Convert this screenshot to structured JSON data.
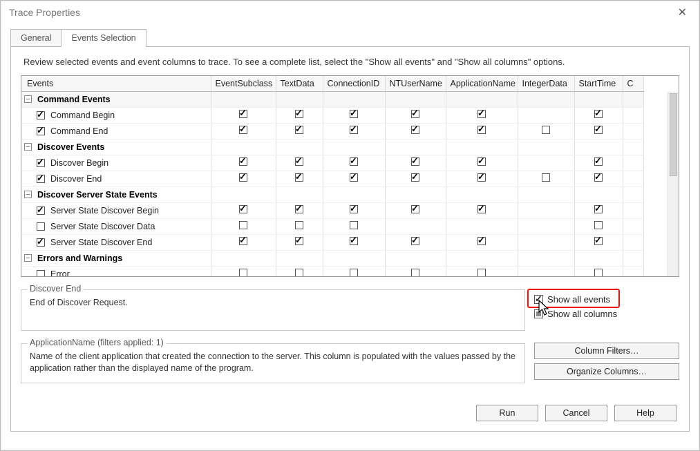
{
  "window": {
    "title": "Trace Properties"
  },
  "tabs": {
    "general": "General",
    "events": "Events Selection",
    "active": "events"
  },
  "hint": "Review selected events and event columns to trace. To see a complete list, select the \"Show all events\" and \"Show all columns\" options.",
  "columns": {
    "events": "Events",
    "c1": "EventSubclass",
    "c2": "TextData",
    "c3": "ConnectionID",
    "c4": "NTUserName",
    "c5": "ApplicationName",
    "c6": "IntegerData",
    "c7": "StartTime",
    "c8": "C"
  },
  "groups": [
    {
      "name": "Command Events",
      "expanded": true,
      "rows": [
        {
          "label": "Command Begin",
          "sel": true,
          "cells": [
            true,
            true,
            true,
            true,
            true,
            null,
            true
          ]
        },
        {
          "label": "Command End",
          "sel": true,
          "cells": [
            true,
            true,
            true,
            true,
            true,
            false,
            true
          ]
        }
      ]
    },
    {
      "name": "Discover Events",
      "expanded": true,
      "rows": [
        {
          "label": "Discover Begin",
          "sel": true,
          "cells": [
            true,
            true,
            true,
            true,
            true,
            null,
            true
          ]
        },
        {
          "label": "Discover End",
          "sel": true,
          "cells": [
            true,
            true,
            true,
            true,
            true,
            false,
            true
          ]
        }
      ]
    },
    {
      "name": "Discover Server State Events",
      "expanded": true,
      "rows": [
        {
          "label": "Server State Discover Begin",
          "sel": true,
          "cells": [
            true,
            true,
            true,
            true,
            true,
            null,
            true
          ]
        },
        {
          "label": "Server State Discover Data",
          "sel": false,
          "cells": [
            false,
            false,
            false,
            null,
            null,
            null,
            false
          ]
        },
        {
          "label": "Server State Discover End",
          "sel": true,
          "cells": [
            true,
            true,
            true,
            true,
            true,
            null,
            true
          ]
        }
      ]
    },
    {
      "name": "Errors and Warnings",
      "expanded": true,
      "rows": [
        {
          "label": "Error",
          "sel": false,
          "cells": [
            false,
            false,
            false,
            false,
            false,
            null,
            false
          ]
        }
      ]
    }
  ],
  "detail": {
    "legend": "Discover End",
    "text": "End of Discover Request."
  },
  "show_all": {
    "events": {
      "label": "Show all events",
      "checked": true
    },
    "columns": {
      "label": "Show all columns",
      "checked": "partial"
    }
  },
  "filterbox": {
    "legend": "ApplicationName (filters applied: 1)",
    "text": "Name of the client application that created the connection to the server. This column is populated with the values passed by the application rather than the displayed name of the program."
  },
  "buttons": {
    "col_filters": "Column Filters…",
    "organize": "Organize Columns…",
    "run": "Run",
    "cancel": "Cancel",
    "help": "Help"
  }
}
